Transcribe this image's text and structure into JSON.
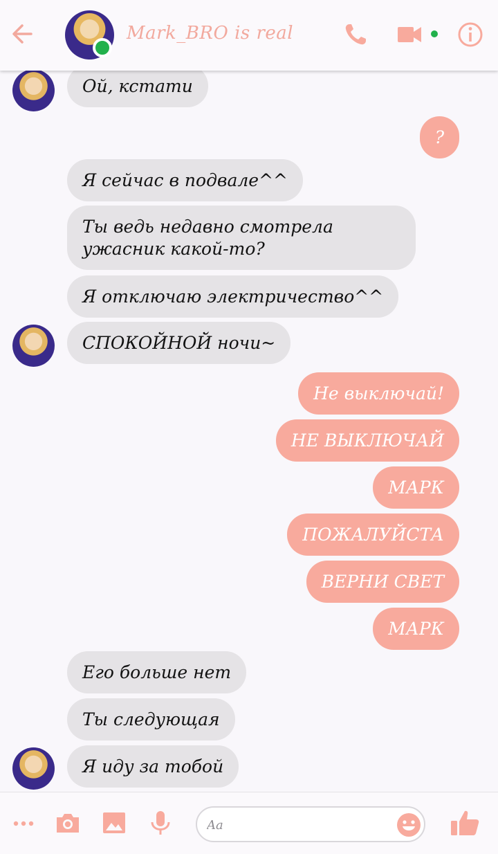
{
  "header": {
    "contact_name": "Mark_BRO is real"
  },
  "messages": [
    {
      "side": "in",
      "text": "Ой, кстати"
    },
    {
      "side": "out",
      "text": "?"
    },
    {
      "side": "in",
      "text": "Я сейчас в подвале^^"
    },
    {
      "side": "in",
      "text": "Ты ведь недавно смотрела ужасник какой-то?"
    },
    {
      "side": "in",
      "text": "Я отключаю электричество^^"
    },
    {
      "side": "in",
      "text": "СПОКОЙНОЙ ночи~"
    },
    {
      "side": "out",
      "text": "Не выключай!"
    },
    {
      "side": "out",
      "text": "НЕ ВЫКЛЮЧАЙ"
    },
    {
      "side": "out",
      "text": "МАРК"
    },
    {
      "side": "out",
      "text": "ПОЖАЛУЙСТА"
    },
    {
      "side": "out",
      "text": "ВЕРНИ СВЕТ"
    },
    {
      "side": "out",
      "text": "МАРК"
    },
    {
      "side": "in",
      "text": "Его больше нет"
    },
    {
      "side": "in",
      "text": "Ты следующая"
    },
    {
      "side": "in",
      "text": "Я иду за тобой"
    }
  ],
  "composer": {
    "placeholder": "Aa"
  },
  "colors": {
    "accent": "#f8aa9d",
    "incoming_bubble": "#e5e3e6",
    "online": "#22b14c"
  },
  "icons": [
    "back-arrow-icon",
    "phone-icon",
    "video-camera-icon",
    "info-icon",
    "more-dots-icon",
    "camera-icon",
    "image-icon",
    "microphone-icon",
    "emoji-icon",
    "thumbs-up-icon"
  ]
}
